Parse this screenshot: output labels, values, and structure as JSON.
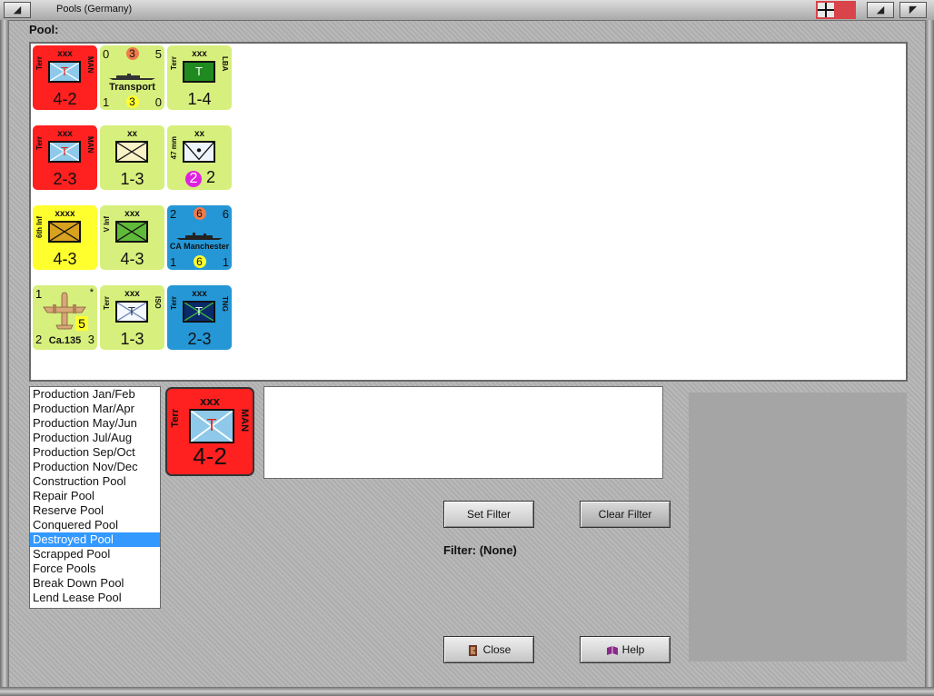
{
  "window": {
    "title": "Pools (Germany)",
    "flag_colors": {
      "field": "#d9434a",
      "cross_bg": "#e8e8e8",
      "cross": "#111111"
    }
  },
  "pool": {
    "label": "Pool:",
    "counters": [
      {
        "kind": "corps",
        "color": "#ff2020",
        "size": "xxx",
        "left": "Terr",
        "right": "MAN",
        "letter": "T",
        "stat": "4-2"
      },
      {
        "kind": "ship",
        "color": "#d7ef7c",
        "tl": "0",
        "tc": "3",
        "tr": "5",
        "name": "Transport",
        "bl": "1",
        "bc": "3",
        "br": "0"
      },
      {
        "kind": "corps",
        "color": "#d7ef7c",
        "size": "xxx",
        "left": "Terr",
        "right": "LBA",
        "letter": "T",
        "stat": "1-4"
      },
      {
        "kind": "corps",
        "color": "#ff2020",
        "size": "xxx",
        "left": "Terr",
        "right": "MAN",
        "letter": "T",
        "stat": "2-3"
      },
      {
        "kind": "inf",
        "color": "#d7ef7c",
        "size": "xx",
        "stat": "1-3"
      },
      {
        "kind": "at",
        "color": "#d7ef7c",
        "size": "xx",
        "left": "47 mm",
        "circ": "2",
        "stat": "2"
      },
      {
        "kind": "inf",
        "color": "#ffff2e",
        "size": "xxxx",
        "left": "6th Inf",
        "stat": "4-3"
      },
      {
        "kind": "inf",
        "color": "#d7ef7c",
        "size": "xxx",
        "left": "V Inf",
        "stat": "4-3"
      },
      {
        "kind": "ship",
        "color": "#2597d6",
        "tl": "2",
        "tc": "6",
        "tr": "6",
        "name": "CA Manchester",
        "bl": "1",
        "bc": "6",
        "br": "1"
      },
      {
        "kind": "air",
        "color": "#d7ef7c",
        "tl": "1",
        "star": "*",
        "val": "5",
        "bl": "2",
        "name": "Ca.135",
        "br": "3"
      },
      {
        "kind": "corps",
        "color": "#d7ef7c",
        "size": "xxx",
        "left": "Terr",
        "right": "ISO",
        "letter": "T",
        "stat": "1-3"
      },
      {
        "kind": "corps",
        "color": "#2597d6",
        "size": "xxx",
        "left": "Terr",
        "right": "TNG",
        "letter": "T",
        "stat": "2-3"
      }
    ]
  },
  "pool_list": {
    "items": [
      "Production Jan/Feb",
      "Production Mar/Apr",
      "Production May/Jun",
      "Production Jul/Aug",
      "Production Sep/Oct",
      "Production Nov/Dec",
      "Construction Pool",
      "Repair Pool",
      "Reserve Pool",
      "Conquered Pool",
      "Destroyed Pool",
      "Scrapped Pool",
      "Force Pools",
      "Break Down Pool",
      "Lend Lease Pool"
    ],
    "selected": "Destroyed Pool"
  },
  "selected_unit": {
    "size": "xxx",
    "left": "Terr",
    "right": "MAN",
    "letter": "T",
    "stat": "4-2"
  },
  "buttons": {
    "set_filter": "Set Filter",
    "clear_filter": "Clear Filter",
    "close": "Close",
    "help": "Help"
  },
  "filter": {
    "label": "Filter: (None)"
  }
}
